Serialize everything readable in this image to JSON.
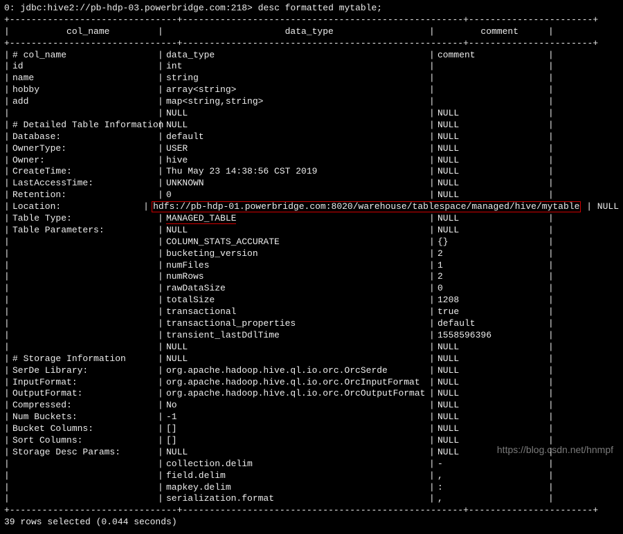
{
  "prompt": {
    "prefix": "0: jdbc:hive2://pb-hdp-03.powerbridge.com:218> ",
    "command": "desc formatted mytable;"
  },
  "sep": {
    "full": "+------------------------------+----------------------------------------------------+-----------------------+"
  },
  "header": {
    "col1": "          col_name           ",
    "col2": "                      data_type                      ",
    "col3": "        comment        "
  },
  "rows": [
    {
      "c1": "# col_name",
      "c2": "data_type",
      "c3": "comment"
    },
    {
      "c1": "id",
      "c2": "int",
      "c3": ""
    },
    {
      "c1": "name",
      "c2": "string",
      "c3": ""
    },
    {
      "c1": "hobby",
      "c2": "array<string>",
      "c3": ""
    },
    {
      "c1": "add",
      "c2": "map<string,string>",
      "c3": ""
    },
    {
      "c1": "",
      "c2": "NULL",
      "c3": "NULL"
    },
    {
      "c1": "# Detailed Table Information",
      "c2": "NULL",
      "c3": "NULL"
    },
    {
      "c1": "Database:",
      "c2": "default",
      "c3": "NULL"
    },
    {
      "c1": "OwnerType:",
      "c2": "USER",
      "c3": "NULL"
    },
    {
      "c1": "Owner:",
      "c2": "hive",
      "c3": "NULL"
    },
    {
      "c1": "CreateTime:",
      "c2": "Thu May 23 14:38:56 CST 2019",
      "c3": "NULL"
    },
    {
      "c1": "LastAccessTime:",
      "c2": "UNKNOWN",
      "c3": "NULL"
    },
    {
      "c1": "Retention:",
      "c2": "0",
      "c3": "NULL"
    },
    {
      "c1": "Location:",
      "c2": "hdfs://pb-hdp-01.powerbridge.com:8020/warehouse/tablespace/managed/hive/mytable",
      "c3": "NULL",
      "hl": "box"
    },
    {
      "c1": "Table Type:",
      "c2": "MANAGED_TABLE",
      "c3": "NULL",
      "hl": "under"
    },
    {
      "c1": "Table Parameters:",
      "c2": "NULL",
      "c3": "NULL"
    },
    {
      "c1": "",
      "c2": "COLUMN_STATS_ACCURATE",
      "c3": "{}"
    },
    {
      "c1": "",
      "c2": "bucketing_version",
      "c3": "2"
    },
    {
      "c1": "",
      "c2": "numFiles",
      "c3": "1"
    },
    {
      "c1": "",
      "c2": "numRows",
      "c3": "2"
    },
    {
      "c1": "",
      "c2": "rawDataSize",
      "c3": "0"
    },
    {
      "c1": "",
      "c2": "totalSize",
      "c3": "1208"
    },
    {
      "c1": "",
      "c2": "transactional",
      "c3": "true"
    },
    {
      "c1": "",
      "c2": "transactional_properties",
      "c3": "default"
    },
    {
      "c1": "",
      "c2": "transient_lastDdlTime",
      "c3": "1558596396"
    },
    {
      "c1": "",
      "c2": "NULL",
      "c3": "NULL"
    },
    {
      "c1": "# Storage Information",
      "c2": "NULL",
      "c3": "NULL"
    },
    {
      "c1": "SerDe Library:",
      "c2": "org.apache.hadoop.hive.ql.io.orc.OrcSerde",
      "c3": "NULL"
    },
    {
      "c1": "InputFormat:",
      "c2": "org.apache.hadoop.hive.ql.io.orc.OrcInputFormat",
      "c3": "NULL"
    },
    {
      "c1": "OutputFormat:",
      "c2": "org.apache.hadoop.hive.ql.io.orc.OrcOutputFormat",
      "c3": "NULL"
    },
    {
      "c1": "Compressed:",
      "c2": "No",
      "c3": "NULL"
    },
    {
      "c1": "Num Buckets:",
      "c2": "-1",
      "c3": "NULL"
    },
    {
      "c1": "Bucket Columns:",
      "c2": "[]",
      "c3": "NULL"
    },
    {
      "c1": "Sort Columns:",
      "c2": "[]",
      "c3": "NULL"
    },
    {
      "c1": "Storage Desc Params:",
      "c2": "NULL",
      "c3": "NULL"
    },
    {
      "c1": "",
      "c2": "collection.delim",
      "c3": "-"
    },
    {
      "c1": "",
      "c2": "field.delim",
      "c3": ","
    },
    {
      "c1": "",
      "c2": "mapkey.delim",
      "c3": ":"
    },
    {
      "c1": "",
      "c2": "serialization.format",
      "c3": ","
    }
  ],
  "footer": "39 rows selected (0.044 seconds)",
  "watermark": "https://blog.csdn.net/hnmpf"
}
